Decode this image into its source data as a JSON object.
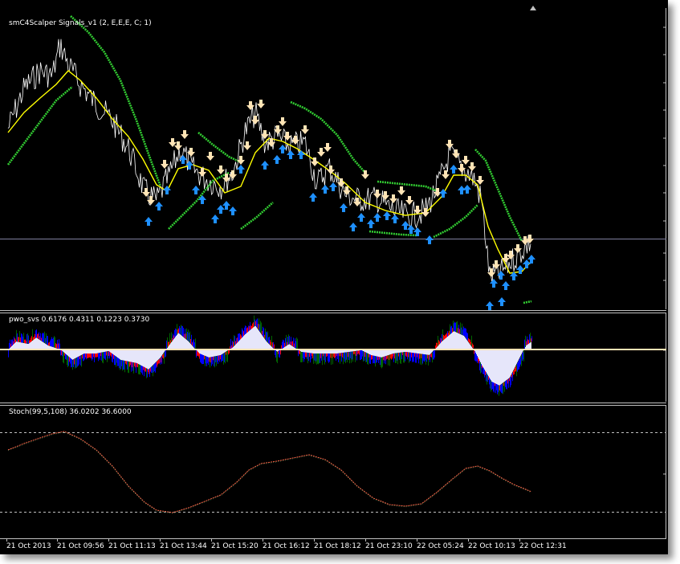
{
  "panels": {
    "main": {
      "label": "smC4Scalper Signals_v1 (2, E,E,E, C; 1)"
    },
    "pwo": {
      "label": "pwo_svs 0.6176 0.4311 0.1223 0.3730"
    },
    "stoch": {
      "label": "Stoch(99,5,108) 36.0202 36.6000"
    }
  },
  "time_axis": {
    "labels": [
      "21 Oct 2013",
      "21 Oct 09:56",
      "21 Oct 11:13",
      "21 Oct 13:44",
      "21 Oct 15:20",
      "21 Oct 16:12",
      "21 Oct 18:12",
      "21 Oct 23:10",
      "22 Oct 05:24",
      "22 Oct 10:13",
      "22 Oct 12:31"
    ]
  },
  "colors": {
    "background": "#000000",
    "price": "#ffffff",
    "ma_slow": "#32cd32",
    "ma_fast": "#ffff00",
    "arrow_down": "#ffe4b5",
    "arrow_up": "#1e90ff",
    "histogram_area": "#e6e6fa",
    "histogram_blue": "#0000ff",
    "histogram_red": "#ff0000",
    "histogram_green": "#006400",
    "zero_line": "#ffe4b5",
    "stoch_line": "#ff6347",
    "level_line": "#c0c0c0"
  },
  "icons": {
    "arrow_down": "down-arrow-signal-icon",
    "arrow_up": "up-arrow-signal-icon",
    "scroll_marker": "shift-marker-icon"
  }
}
